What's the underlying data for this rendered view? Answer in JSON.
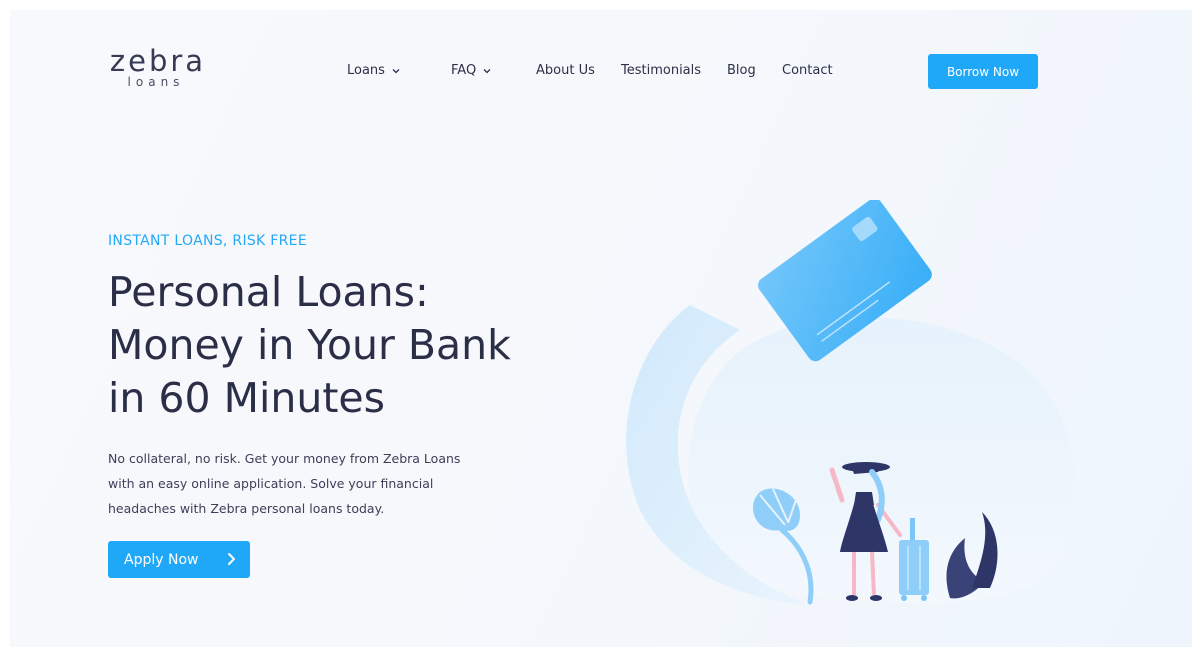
{
  "logo": {
    "main": "zebra",
    "sub": "loans"
  },
  "nav": {
    "items": [
      {
        "label": "Loans",
        "has_dropdown": true
      },
      {
        "label": "FAQ",
        "has_dropdown": true
      },
      {
        "label": "About Us",
        "has_dropdown": false
      },
      {
        "label": "Testimonials",
        "has_dropdown": false
      },
      {
        "label": "Blog",
        "has_dropdown": false
      },
      {
        "label": "Contact",
        "has_dropdown": false
      }
    ],
    "cta_label": "Borrow Now"
  },
  "hero": {
    "eyebrow": "INSTANT LOANS, RISK FREE",
    "headline_lines": [
      "Personal Loans:",
      "Money in Your Bank",
      "in 60 Minutes"
    ],
    "body_lines": [
      "No collateral, no risk. Get your money from Zebra Loans",
      "with an easy online application. Solve your financial",
      "headaches with Zebra personal loans today."
    ],
    "cta_label": "Apply Now"
  },
  "colors": {
    "accent": "#20a8f8",
    "heading": "#2a2e47",
    "eyebrow": "#23a9f6",
    "background": "#f6f8fc"
  },
  "icons": [
    "chevron-down-icon",
    "chevron-right-icon",
    "credit-card-illustration",
    "traveler-illustration",
    "suitcase-illustration",
    "palm-leaf-illustration"
  ]
}
